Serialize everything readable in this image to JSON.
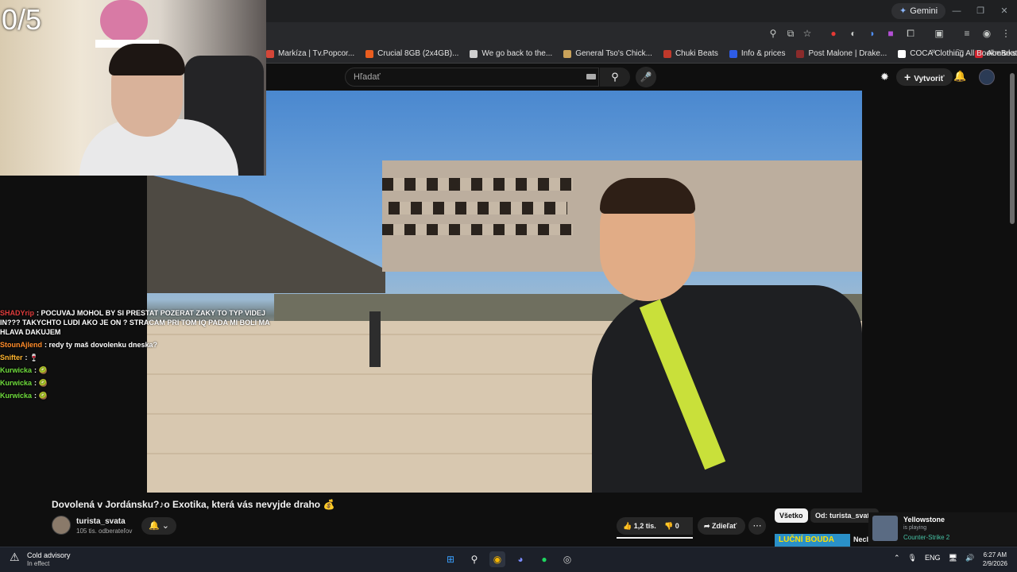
{
  "browser": {
    "gemini_label": "Gemini",
    "bookmarks": [
      {
        "label": "Markíza | Tv.Popcor...",
        "color": "#d44638"
      },
      {
        "label": "Crucial 8GB (2x4GB)...",
        "color": "#e95d1f"
      },
      {
        "label": "We go back to the...",
        "color": "#cfcfcf"
      },
      {
        "label": "General Tso's Chick...",
        "color": "#c9a25a"
      },
      {
        "label": "Chuki Beats",
        "color": "#c0392b"
      },
      {
        "label": "Info & prices",
        "color": "#2e5ce6"
      },
      {
        "label": "Post Malone | Drake...",
        "color": "#8a2b2b"
      },
      {
        "label": "COCA Clothing",
        "color": "#ffffff"
      },
      {
        "label": "AbeBeats",
        "color": "#d1242f"
      }
    ],
    "all_bookmarks": "All Bookmarks"
  },
  "youtube": {
    "search_placeholder": "Hľadať",
    "create_label": "Vytvoriť",
    "video_title": "Dovolená v Jordánsku?♪o Exotika, která vás nevyjde draho 💰",
    "channel_name": "turista_svata",
    "channel_subs": "105 tis. odberateľov",
    "likes": "1,2 tis.",
    "dislikes": "0",
    "share_label": "Zdieľať",
    "chips": [
      "Všetko",
      "Od: turista_svata"
    ],
    "next_thumb_text": "LUČNÍ BOUDA",
    "next_thumb_side": "Necl"
  },
  "stream": {
    "counter": "0/5",
    "chat": [
      {
        "user": "SHADYrip",
        "user_color": "#e03c3c",
        "text": ": POCUVAJ MOHOL BY SI PRESTAT POZERAT ZAKY TO TYP VIDEJ IN??? TAKYCHTO LUDI AKO JE ON ? STRACAM PRI TOM IQ PADA MI BOLI MA HLAVA DAKUJEM"
      },
      {
        "user": "StounAjlend",
        "user_color": "#ff8c2a",
        "text": ": redy ty maš dovolenku dneska?"
      },
      {
        "user": "Snifter",
        "user_color": "#ffb52e",
        "text": ": 🍷"
      },
      {
        "user": "Kurwicka",
        "user_color": "#6fdc3c",
        "text": ": 🥝"
      },
      {
        "user": "Kurwicka",
        "user_color": "#6fdc3c",
        "text": ": 🥝"
      },
      {
        "user": "Kurwicka",
        "user_color": "#6fdc3c",
        "text": ": 🥝"
      }
    ]
  },
  "popup": {
    "title": "Yellowstone",
    "status": "is playing",
    "game": "Counter-Strike 2"
  },
  "taskbar": {
    "weather_title": "Cold advisory",
    "weather_sub": "In effect",
    "lang": "ENG",
    "time": "6:27 AM",
    "date": "2/9/2026"
  }
}
